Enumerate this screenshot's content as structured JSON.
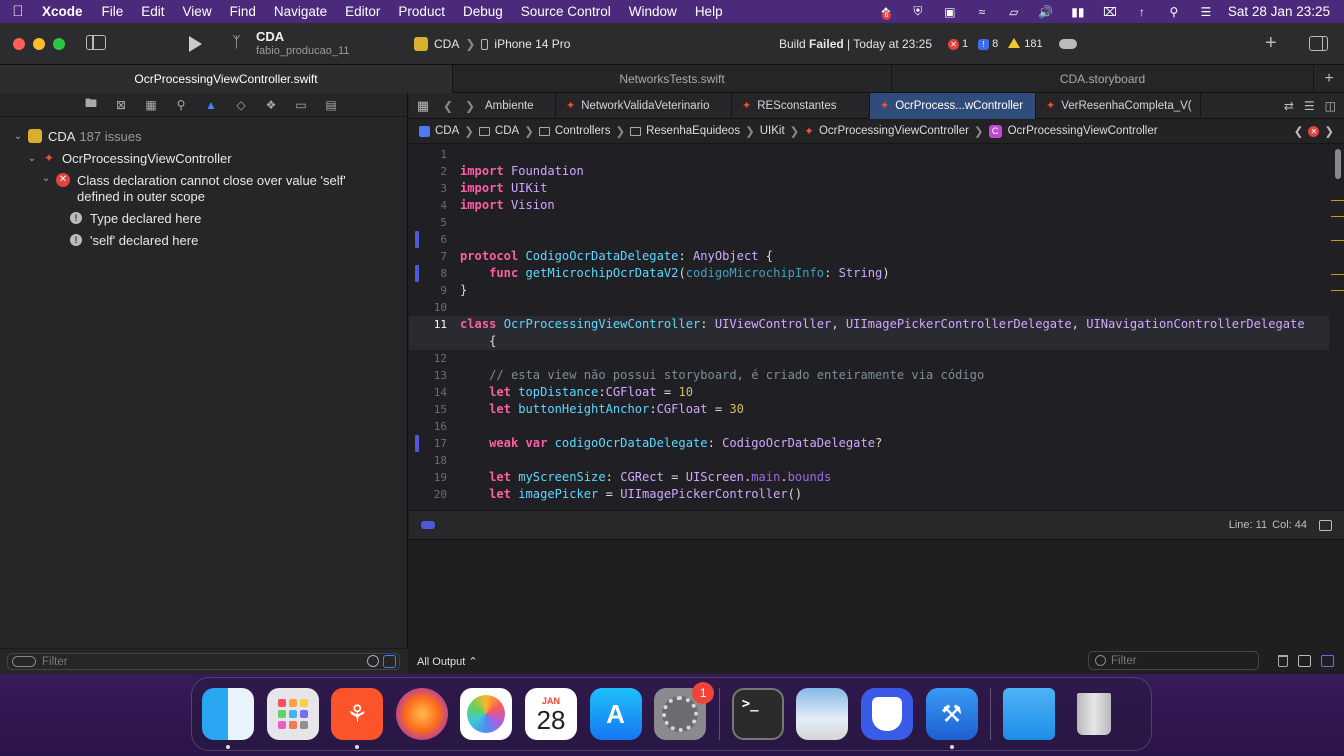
{
  "menubar": {
    "app_name": "Xcode",
    "items": [
      "File",
      "Edit",
      "View",
      "Find",
      "Navigate",
      "Editor",
      "Product",
      "Debug",
      "Source Control",
      "Window",
      "Help"
    ],
    "dropbox_badge": "6",
    "clock": "Sat 28 Jan  23:25"
  },
  "toolbar": {
    "project_name": "CDA",
    "branch": "fabio_producao_11",
    "scheme": "CDA",
    "device": "iPhone 14 Pro",
    "status_prefix": "Build ",
    "status_state": "Failed",
    "status_suffix": " | Today at 23:25",
    "errors": "1",
    "infos": "8",
    "warnings": "181"
  },
  "file_tabs": [
    "OcrProcessingViewController.swift",
    "NetworksTests.swift",
    "CDA.storyboard"
  ],
  "navigator": {
    "project": "CDA",
    "issue_count": "187 issues",
    "file": "OcrProcessingViewController",
    "error_message": "Class declaration cannot close over value 'self' defined in outer scope",
    "error_line1": "Class declaration cannot close over value 'self'",
    "error_line2": "defined in outer scope",
    "notes": [
      "Type declared here",
      "'self' declared here"
    ],
    "filter_placeholder": "Filter"
  },
  "editor_tabs": [
    "Ambiente",
    "NetworkValidaVeterinario",
    "RESconstantes",
    "OcrProcess...wController",
    "VerResenhaCompleta_V("
  ],
  "jumpbar": [
    "CDA",
    "CDA",
    "Controllers",
    "ResenhaEquideos",
    "UIKit",
    "OcrProcessingViewController",
    "OcrProcessingViewController"
  ],
  "code": {
    "current_line": 11,
    "lines": [
      {
        "n": "1",
        "t": ""
      },
      {
        "n": "2",
        "t": "import Foundation"
      },
      {
        "n": "3",
        "t": "import UIKit"
      },
      {
        "n": "4",
        "t": "import Vision"
      },
      {
        "n": "5",
        "t": ""
      },
      {
        "n": "6",
        "t": ""
      },
      {
        "n": "7",
        "t": "protocol CodigoOcrDataDelegate: AnyObject {"
      },
      {
        "n": "8",
        "t": "    func getMicrochipOcrDataV2(codigoMicrochipInfo: String)"
      },
      {
        "n": "9",
        "t": "}"
      },
      {
        "n": "10",
        "t": ""
      },
      {
        "n": "11",
        "t": "class OcrProcessingViewController: UIViewController, UIImagePickerControllerDelegate, UINavigationControllerDelegate"
      },
      {
        "n": "",
        "t": "    {"
      },
      {
        "n": "12",
        "t": ""
      },
      {
        "n": "13",
        "t": "    // esta view não possui storyboard, é criado enteiramente via código"
      },
      {
        "n": "14",
        "t": "    let topDistance:CGFloat = 10"
      },
      {
        "n": "15",
        "t": "    let buttonHeightAnchor:CGFloat = 30"
      },
      {
        "n": "16",
        "t": ""
      },
      {
        "n": "17",
        "t": "    weak var codigoOcrDataDelegate: CodigoOcrDataDelegate?"
      },
      {
        "n": "18",
        "t": ""
      },
      {
        "n": "19",
        "t": "    let myScreenSize: CGRect = UIScreen.main.bounds"
      },
      {
        "n": "20",
        "t": "    let imagePicker = UIImagePickerController()"
      }
    ]
  },
  "debug": {
    "line_label": "Line: 11",
    "col_label": "Col: 44"
  },
  "console": {
    "output_label": "All Output ⌃",
    "filter_placeholder": "Filter"
  },
  "dock": {
    "apps": [
      "Finder",
      "Launchpad",
      "Brave Browser",
      "Firefox",
      "Photos",
      "Calendar",
      "App Store",
      "System Settings",
      "Terminal",
      "Preview",
      "VPN",
      "Xcode",
      "Downloads",
      "Trash"
    ],
    "calendar_month": "JAN",
    "calendar_day": "28",
    "settings_badge": "1"
  },
  "colors": {
    "accent": "#4b7cf5",
    "error": "#e0443e",
    "warning": "#f2c832",
    "keyword": "#fc5fa3",
    "type_decl": "#5dd8ff",
    "number": "#d0bf69",
    "comment": "#7f8c98"
  }
}
